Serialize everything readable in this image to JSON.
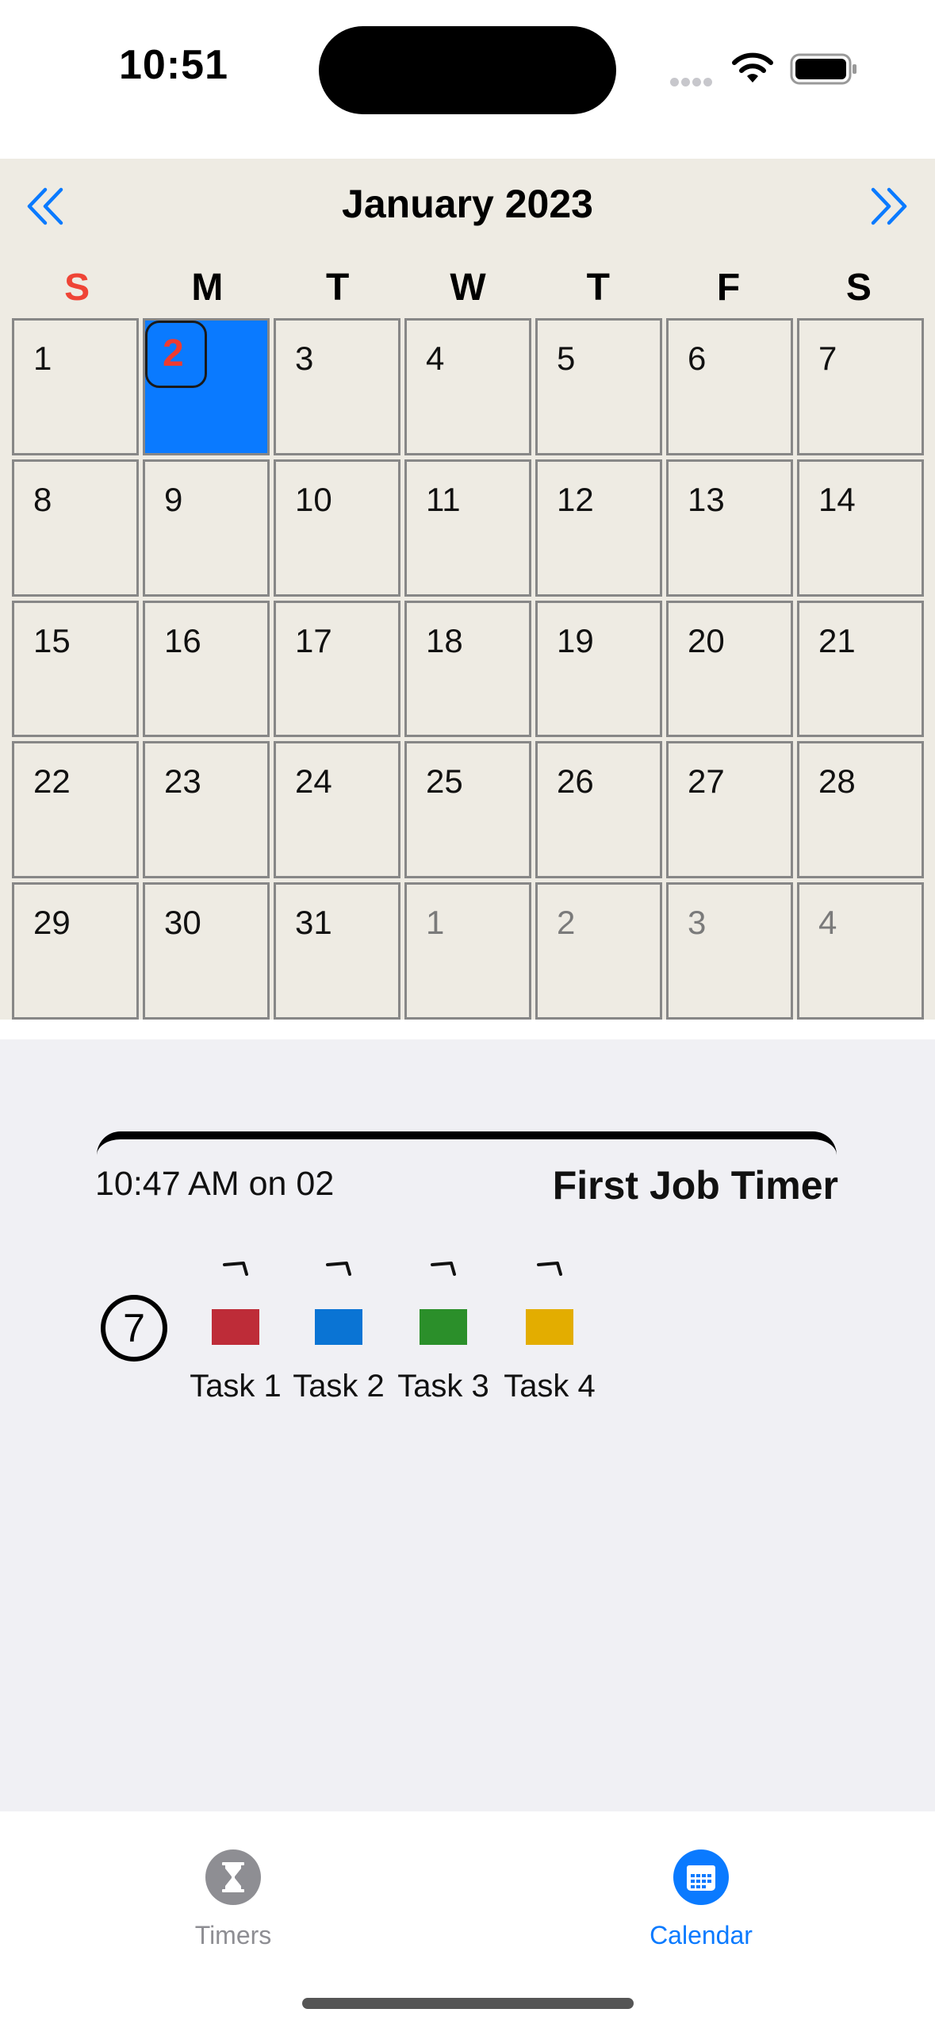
{
  "status_bar": {
    "time": "10:51"
  },
  "calendar": {
    "month_title": "January 2023",
    "weekdays": [
      "S",
      "M",
      "T",
      "W",
      "T",
      "F",
      "S"
    ],
    "weeks": [
      [
        "1",
        "2",
        "3",
        "4",
        "5",
        "6",
        "7"
      ],
      [
        "8",
        "9",
        "10",
        "11",
        "12",
        "13",
        "14"
      ],
      [
        "15",
        "16",
        "17",
        "18",
        "19",
        "20",
        "21"
      ],
      [
        "22",
        "23",
        "24",
        "25",
        "26",
        "27",
        "28"
      ],
      [
        "29",
        "30",
        "31",
        "1",
        "2",
        "3",
        "4"
      ]
    ],
    "selected_day": "2",
    "colors": {
      "accent": "#0a7aff",
      "sunday": "#ef4436",
      "today_number": "#ef3b30",
      "background": "#eeebe3"
    }
  },
  "entry": {
    "time": "10:47 AM on 02",
    "title": "First Job Timer",
    "count": "7",
    "tasks": [
      {
        "label": "Task 1",
        "color": "#be2c38"
      },
      {
        "label": "Task 2",
        "color": "#0a74d4"
      },
      {
        "label": "Task 3",
        "color": "#2b8f2a"
      },
      {
        "label": "Task 4",
        "color": "#e3ad00"
      }
    ]
  },
  "tabbar": {
    "tabs": [
      {
        "label": "Timers",
        "icon": "hourglass-icon",
        "selected": false
      },
      {
        "label": "Calendar",
        "icon": "calendar-icon",
        "selected": true
      }
    ]
  }
}
